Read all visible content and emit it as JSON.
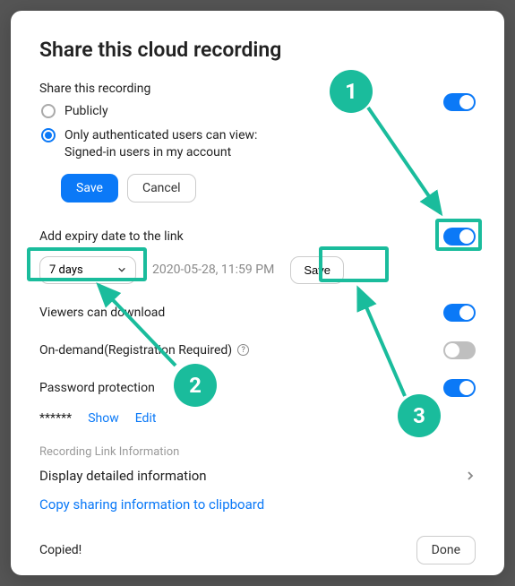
{
  "title": "Share this cloud recording",
  "shareLabel": "Share this recording",
  "radios": {
    "publicly": "Publicly",
    "authLine1": "Only authenticated users can view:",
    "authLine2": "Signed-in users in my account"
  },
  "buttons": {
    "save": "Save",
    "cancel": "Cancel",
    "expirySave": "Save",
    "done": "Done"
  },
  "settings": {
    "expiryLabel": "Add expiry date to the link",
    "expirySelectValue": "7 days",
    "expiryTimestamp": "2020-05-28, 11:59 PM",
    "viewersDownload": "Viewers can download",
    "onDemand": "On-demand(Registration Required)",
    "passwordProtection": "Password protection"
  },
  "password": {
    "masked": "******",
    "show": "Show",
    "edit": "Edit"
  },
  "recInfoLabel": "Recording Link Information",
  "displayDetail": "Display detailed information",
  "copySharing": "Copy sharing information to clipboard",
  "copied": "Copied!",
  "callouts": {
    "one": "1",
    "two": "2",
    "three": "3"
  },
  "helpGlyph": "?"
}
